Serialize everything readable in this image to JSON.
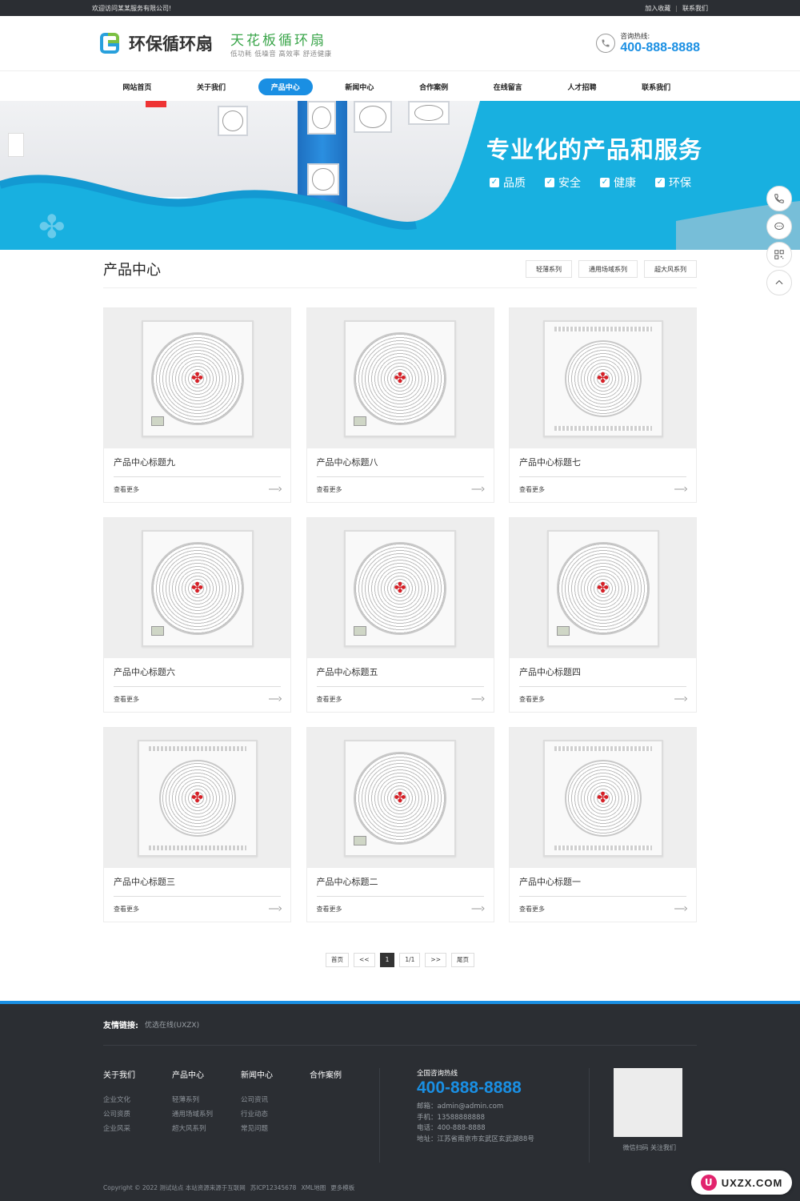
{
  "topbar": {
    "welcome": "欢迎访问某某服务有限公司!",
    "links": [
      "加入收藏",
      "联系我们"
    ]
  },
  "header": {
    "brand_name": "环保循环扇",
    "slogan_main": "天花板循环扇",
    "slogan_sub": "低功耗 低噪音 高效率 舒适健康",
    "hotline_label": "咨询热线:",
    "hotline_number": "400-888-8888"
  },
  "nav": {
    "items": [
      "网站首页",
      "关于我们",
      "产品中心",
      "新闻中心",
      "合作案例",
      "在线留言",
      "人才招聘",
      "联系我们"
    ],
    "active_index": 2
  },
  "banner": {
    "headline": "专业化的产品和服务",
    "features": [
      "品质",
      "安全",
      "健康",
      "环保"
    ]
  },
  "section": {
    "title": "产品中心",
    "filters": [
      "轻薄系列",
      "通用场域系列",
      "超大风系列"
    ]
  },
  "products": [
    {
      "title": "产品中心标题九",
      "more": "查看更多",
      "style": "square"
    },
    {
      "title": "产品中心标题八",
      "more": "查看更多",
      "style": "square"
    },
    {
      "title": "产品中心标题七",
      "more": "查看更多",
      "style": "vent"
    },
    {
      "title": "产品中心标题六",
      "more": "查看更多",
      "style": "square"
    },
    {
      "title": "产品中心标题五",
      "more": "查看更多",
      "style": "square"
    },
    {
      "title": "产品中心标题四",
      "more": "查看更多",
      "style": "square"
    },
    {
      "title": "产品中心标题三",
      "more": "查看更多",
      "style": "vent"
    },
    {
      "title": "产品中心标题二",
      "more": "查看更多",
      "style": "square"
    },
    {
      "title": "产品中心标题一",
      "more": "查看更多",
      "style": "vent"
    }
  ],
  "pager": {
    "first": "首页",
    "prev": "<<",
    "current": "1",
    "total": "1/1",
    "next": ">>",
    "last": "尾页"
  },
  "footer": {
    "friend_label": "友情链接:",
    "friend_link": "优选在线(UXZX)",
    "columns": [
      {
        "title": "关于我们",
        "items": [
          "企业文化",
          "公司资质",
          "企业风采"
        ]
      },
      {
        "title": "产品中心",
        "items": [
          "轻薄系列",
          "通用场域系列",
          "超大风系列"
        ]
      },
      {
        "title": "新闻中心",
        "items": [
          "公司资讯",
          "行业动态",
          "常见问题"
        ]
      },
      {
        "title": "合作案例",
        "items": []
      }
    ],
    "contact_title": "全国咨询热线",
    "contact_number": "400-888-8888",
    "contact_lines": [
      "邮箱：admin@admin.com",
      "手机：13588888888",
      "电话：400-888-8888",
      "地址：江苏省南京市玄武区玄武湖88号"
    ],
    "qr_caption": "微信扫码 关注我们",
    "copyright": [
      "Copyright © 2022 测试站点 本站资源来源于互联网",
      "苏ICP12345678",
      "XML地图",
      "更多模板"
    ]
  },
  "watermark": "UXZX.COM",
  "colors": {
    "accent": "#1a8fe3",
    "banner": "#18b0e0",
    "footer": "#2b2e33",
    "logo_green": "#3aa54a"
  }
}
